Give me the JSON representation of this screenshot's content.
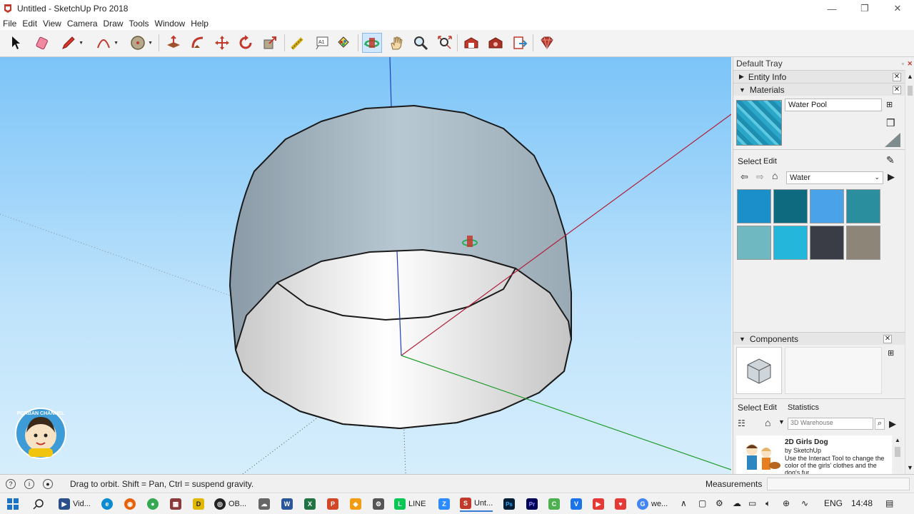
{
  "window": {
    "title": "Untitled - SketchUp Pro 2018",
    "controls": [
      "—",
      "❐",
      "✕"
    ]
  },
  "menu": [
    "File",
    "Edit",
    "View",
    "Camera",
    "Draw",
    "Tools",
    "Window",
    "Help"
  ],
  "toolbar": {
    "tools": [
      {
        "name": "select-tool",
        "icon": "arrow-icon"
      },
      {
        "name": "eraser-tool",
        "icon": "eraser-icon"
      },
      {
        "name": "line-tool",
        "icon": "pencil-icon"
      },
      {
        "name": "arc-tool",
        "icon": "arc-icon"
      },
      {
        "name": "shapes-tool",
        "icon": "circle-icon"
      },
      {
        "name": "push-pull-tool",
        "icon": "push-pull-icon"
      },
      {
        "name": "follow-me-tool",
        "icon": "follow-me-icon"
      },
      {
        "name": "move-tool",
        "icon": "move-icon"
      },
      {
        "name": "rotate-tool",
        "icon": "rotate-icon"
      },
      {
        "name": "scale-tool",
        "icon": "scale-icon"
      },
      {
        "name": "tape-measure-tool",
        "icon": "tape-icon"
      },
      {
        "name": "text-tool",
        "icon": "text-icon"
      },
      {
        "name": "paint-bucket-tool",
        "icon": "paint-bucket-icon"
      },
      {
        "name": "orbit-tool",
        "icon": "orbit-icon"
      },
      {
        "name": "pan-tool",
        "icon": "hand-icon"
      },
      {
        "name": "zoom-tool",
        "icon": "zoom-icon"
      },
      {
        "name": "zoom-extents-tool",
        "icon": "zoom-extents-icon"
      },
      {
        "name": "3d-warehouse-tool",
        "icon": "warehouse-icon"
      },
      {
        "name": "extension-warehouse-tool",
        "icon": "extension-icon"
      },
      {
        "name": "send-to-layout-tool",
        "icon": "layout-icon"
      },
      {
        "name": "extension-manager-tool",
        "icon": "ruby-icon"
      }
    ],
    "active_tool": "orbit-tool"
  },
  "tray": {
    "title": "Default Tray",
    "entity_info": {
      "label": "Entity Info",
      "expanded": false
    },
    "materials": {
      "label": "Materials",
      "expanded": true,
      "material_name": "Water Pool",
      "tabs": [
        "Select",
        "Edit"
      ],
      "library": "Water",
      "swatch_colors": [
        "#1b8fc9",
        "#0e6b7f",
        "#4aa3e8",
        "#2a8e9e",
        "#6fb8c2",
        "#25b6dc",
        "#3a3d45",
        "#8d8577"
      ]
    },
    "components": {
      "label": "Components",
      "expanded": true,
      "tabs": [
        "Select",
        "Edit",
        "Statistics"
      ],
      "search_placeholder": "3D Warehouse",
      "item": {
        "title": "2D Girls Dog",
        "author": "by SketchUp",
        "description": "Use the Interact Tool to change the color of the girls' clothes and the dog's fur."
      }
    }
  },
  "status": {
    "message": "Drag to orbit. Shift = Pan, Ctrl = suspend gravity.",
    "measurements_label": "Measurements",
    "measurements_value": ""
  },
  "watermark": {
    "text": "PORBAN CHANNEL"
  },
  "taskbar": {
    "items": [
      {
        "label": "Vid...",
        "color": "#2a4f8a",
        "glyph": "▶"
      },
      {
        "label": "",
        "color": "#0c8ad4",
        "glyph": "e"
      },
      {
        "label": "",
        "color": "#e8620c",
        "glyph": "◉"
      },
      {
        "label": "",
        "color": "#34a853",
        "glyph": "●"
      },
      {
        "label": "",
        "color": "#8a3a3a",
        "glyph": "▦"
      },
      {
        "label": "",
        "color": "#e0b800",
        "glyph": "D"
      },
      {
        "label": "OB...",
        "color": "#222222",
        "glyph": "◎"
      },
      {
        "label": "",
        "color": "#666666",
        "glyph": "☁"
      },
      {
        "label": "",
        "color": "#2b579a",
        "glyph": "W"
      },
      {
        "label": "",
        "color": "#217346",
        "glyph": "X"
      },
      {
        "label": "",
        "color": "#d24726",
        "glyph": "P"
      },
      {
        "label": "",
        "color": "#f39c12",
        "glyph": "◆"
      },
      {
        "label": "",
        "color": "#555555",
        "glyph": "⚙"
      },
      {
        "label": "LINE",
        "color": "#06c755",
        "glyph": "L"
      },
      {
        "label": "",
        "color": "#2d8cff",
        "glyph": "Z"
      },
      {
        "label": "Unt...",
        "color": "#c0392b",
        "glyph": "S"
      },
      {
        "label": "",
        "color": "#001e36",
        "glyph": "Ps"
      },
      {
        "label": "",
        "color": "#00005b",
        "glyph": "Pr"
      },
      {
        "label": "",
        "color": "#4caf50",
        "glyph": "C"
      },
      {
        "label": "",
        "color": "#1a73e8",
        "glyph": "V"
      },
      {
        "label": "",
        "color": "#e53935",
        "glyph": "▶"
      },
      {
        "label": "",
        "color": "#e53935",
        "glyph": "♥"
      },
      {
        "label": "we...",
        "color": "#4285f4",
        "glyph": "G"
      }
    ],
    "lang": "ENG",
    "time": "14:48"
  }
}
